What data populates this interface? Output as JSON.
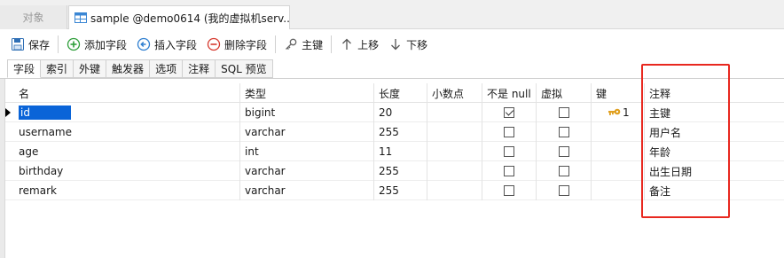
{
  "document_tabs": {
    "objects_label": "对象",
    "active_label": "sample @demo0614 (我的虚拟机serv..."
  },
  "toolbar": {
    "save_label": "保存",
    "add_field_label": "添加字段",
    "insert_field_label": "插入字段",
    "delete_field_label": "删除字段",
    "primary_key_label": "主键",
    "move_up_label": "上移",
    "move_down_label": "下移"
  },
  "sub_tabs": [
    "字段",
    "索引",
    "外键",
    "触发器",
    "选项",
    "注释",
    "SQL 预览"
  ],
  "columns": [
    "名",
    "类型",
    "长度",
    "小数点",
    "不是 null",
    "虚拟",
    "键",
    "注释"
  ],
  "rows": [
    {
      "name": "id",
      "type": "bigint",
      "length": "20",
      "decimals": "",
      "not_null": true,
      "virtual": false,
      "key": "1",
      "comment": "主键"
    },
    {
      "name": "username",
      "type": "varchar",
      "length": "255",
      "decimals": "",
      "not_null": false,
      "virtual": false,
      "key": "",
      "comment": "用户名"
    },
    {
      "name": "age",
      "type": "int",
      "length": "11",
      "decimals": "",
      "not_null": false,
      "virtual": false,
      "key": "",
      "comment": "年龄"
    },
    {
      "name": "birthday",
      "type": "varchar",
      "length": "255",
      "decimals": "",
      "not_null": false,
      "virtual": false,
      "key": "",
      "comment": "出生日期"
    },
    {
      "name": "remark",
      "type": "varchar",
      "length": "255",
      "decimals": "",
      "not_null": false,
      "virtual": false,
      "key": "",
      "comment": "备注"
    }
  ],
  "selected_row": 0,
  "colors": {
    "selection": "#0a64d8",
    "highlight_box": "#e8281f",
    "key_icon": "#e0a020"
  },
  "icons": {
    "save": "floppy-disk-icon",
    "add_field": "plus-circle-icon",
    "insert_field": "left-arrow-circle-icon",
    "delete_field": "minus-circle-icon",
    "primary_key": "key-icon",
    "move_up": "arrow-up-icon",
    "move_down": "arrow-down-icon"
  }
}
